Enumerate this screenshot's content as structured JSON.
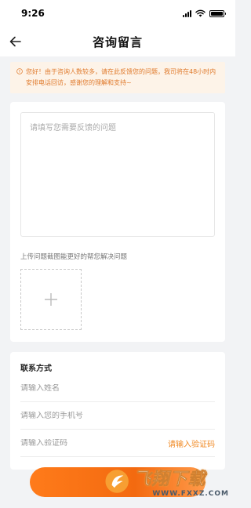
{
  "status_bar": {
    "time": "9:26"
  },
  "nav": {
    "title": "咨询留言"
  },
  "notice": {
    "text": "您好！由于咨询人数较多，请在此反馈您的问题，我司将在48小时内安排电话回访，感谢您的理解和支持~"
  },
  "feedback": {
    "placeholder": "请填写您需要反馈的问题",
    "upload_hint": "上传问题截图能更好的帮您解决问题"
  },
  "contact": {
    "title": "联系方式",
    "name_placeholder": "请输入姓名",
    "phone_placeholder": "请输入您的手机号",
    "code_placeholder": "请输入验证码",
    "code_button": "请输入验证码"
  },
  "watermark": {
    "brand": "飞翔下载",
    "url": "WWW.FXXZ.COM"
  },
  "colors": {
    "accent": "#f08a24",
    "notice_bg": "#fdf3e8",
    "page_bg": "#f2f3f5"
  }
}
